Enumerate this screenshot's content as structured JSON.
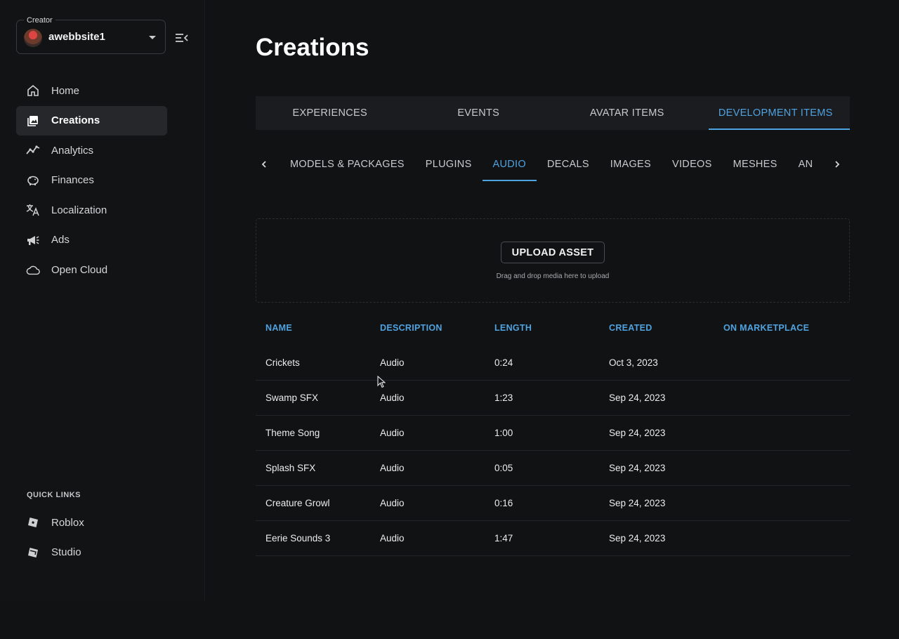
{
  "creator": {
    "legend": "Creator",
    "name": "awebbsite1"
  },
  "sidebar": {
    "items": [
      {
        "label": "Home",
        "icon": "home-icon"
      },
      {
        "label": "Creations",
        "icon": "creations-icon",
        "active": true
      },
      {
        "label": "Analytics",
        "icon": "analytics-icon"
      },
      {
        "label": "Finances",
        "icon": "piggy-bank-icon"
      },
      {
        "label": "Localization",
        "icon": "translate-icon"
      },
      {
        "label": "Ads",
        "icon": "megaphone-icon"
      },
      {
        "label": "Open Cloud",
        "icon": "cloud-icon"
      }
    ],
    "quick_links_title": "QUICK LINKS",
    "quick_links": [
      {
        "label": "Roblox",
        "icon": "roblox-logo-icon"
      },
      {
        "label": "Studio",
        "icon": "roblox-studio-icon"
      }
    ]
  },
  "page": {
    "title": "Creations"
  },
  "top_tabs": [
    "EXPERIENCES",
    "EVENTS",
    "AVATAR ITEMS",
    "DEVELOPMENT ITEMS"
  ],
  "top_tab_active": "DEVELOPMENT ITEMS",
  "sub_tabs": [
    "MODELS & PACKAGES",
    "PLUGINS",
    "AUDIO",
    "DECALS",
    "IMAGES",
    "VIDEOS",
    "MESHES",
    "AN"
  ],
  "sub_tab_active": "AUDIO",
  "upload": {
    "button_label": "UPLOAD ASSET",
    "hint": "Drag and drop media here to upload"
  },
  "table": {
    "columns": [
      "NAME",
      "DESCRIPTION",
      "LENGTH",
      "CREATED",
      "ON MARKETPLACE"
    ],
    "rows": [
      [
        "Crickets",
        "Audio",
        "0:24",
        "Oct 3, 2023",
        ""
      ],
      [
        "Swamp SFX",
        "Audio",
        "1:23",
        "Sep 24, 2023",
        ""
      ],
      [
        "Theme Song",
        "Audio",
        "1:00",
        "Sep 24, 2023",
        ""
      ],
      [
        "Splash SFX",
        "Audio",
        "0:05",
        "Sep 24, 2023",
        ""
      ],
      [
        "Creature Growl",
        "Audio",
        "0:16",
        "Sep 24, 2023",
        ""
      ],
      [
        "Eerie Sounds 3",
        "Audio",
        "1:47",
        "Sep 24, 2023",
        ""
      ]
    ]
  },
  "colors": {
    "accent": "#4fa3e0",
    "background": "#111214",
    "active_nav": "#26272b"
  }
}
